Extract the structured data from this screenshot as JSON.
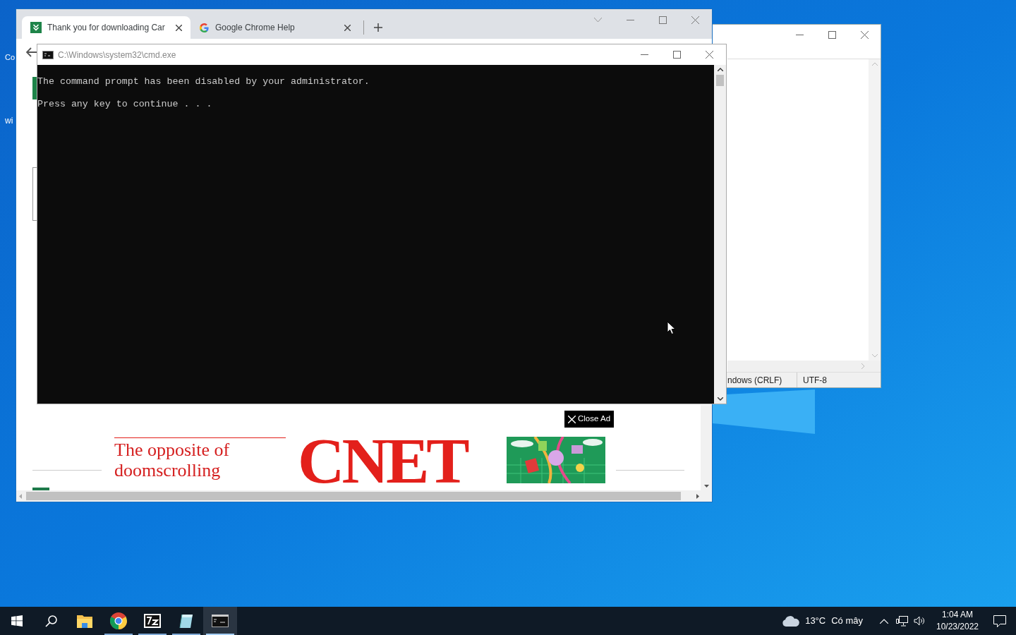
{
  "desktop": {
    "icon_labels": [
      "Co",
      "wi"
    ]
  },
  "notepad": {
    "status_bar": [
      "ndows (CRLF)",
      "UTF-8"
    ]
  },
  "chrome": {
    "tabs": [
      {
        "title": "Thank you for downloading Car",
        "selected": true
      },
      {
        "title": "Google Chrome Help",
        "selected": false
      }
    ],
    "page": {
      "ad": {
        "close_label": "Close Ad",
        "tagline": "The opposite of doomscrolling",
        "logo": "CNET"
      }
    }
  },
  "cmd": {
    "title": "C:\\Windows\\system32\\cmd.exe",
    "lines": [
      "The command prompt has been disabled by your administrator.",
      "Press any key to continue . . ."
    ]
  },
  "taskbar": {
    "apps": [
      {
        "kind": "explorer",
        "running": false,
        "selected": false
      },
      {
        "kind": "chrome",
        "running": true,
        "selected": false
      },
      {
        "kind": "sevenzip",
        "running": true,
        "selected": false
      },
      {
        "kind": "notepad",
        "running": true,
        "selected": false
      },
      {
        "kind": "console",
        "running": true,
        "selected": true
      }
    ],
    "weather": {
      "temperature": "13°C",
      "condition": "Có mây"
    },
    "clock": {
      "time": "1:04 AM",
      "date": "10/23/2022"
    }
  }
}
